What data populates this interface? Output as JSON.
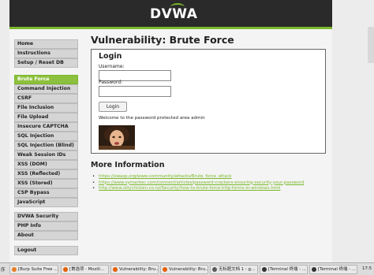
{
  "app": {
    "logo_text": "DVWA",
    "accent_color": "#7ab829",
    "header_color": "#2a2a2a"
  },
  "sidebar": {
    "items": [
      {
        "label": "Home",
        "active": false
      },
      {
        "label": "Instructions",
        "active": false
      },
      {
        "label": "Setup / Reset DB",
        "active": false
      },
      {
        "label": "Brute Force",
        "active": true
      },
      {
        "label": "Command Injection",
        "active": false
      },
      {
        "label": "CSRF",
        "active": false
      },
      {
        "label": "File Inclusion",
        "active": false
      },
      {
        "label": "File Upload",
        "active": false
      },
      {
        "label": "Insecure CAPTCHA",
        "active": false
      },
      {
        "label": "SQL Injection",
        "active": false
      },
      {
        "label": "SQL Injection (Blind)",
        "active": false
      },
      {
        "label": "Weak Session IDs",
        "active": false
      },
      {
        "label": "XSS (DOM)",
        "active": false
      },
      {
        "label": "XSS (Reflected)",
        "active": false
      },
      {
        "label": "XSS (Stored)",
        "active": false
      },
      {
        "label": "CSP Bypass",
        "active": false
      },
      {
        "label": "JavaScript",
        "active": false
      },
      {
        "label": "DVWA Security",
        "active": false
      },
      {
        "label": "PHP Info",
        "active": false
      },
      {
        "label": "About",
        "active": false
      },
      {
        "label": "Logout",
        "active": false
      }
    ]
  },
  "main": {
    "title": "Vulnerability: Brute Force",
    "login": {
      "heading": "Login",
      "username_label": "Username:",
      "username_value": "",
      "password_label": "Password:",
      "password_value": "",
      "button_label": "Login",
      "welcome_text": "Welcome to the password protected area admin"
    },
    "more_info": {
      "heading": "More Information",
      "links": [
        "https://owasp.org/www-community/attacks/Brute_force_attack",
        "https://www.symantec.com/connect/articles/password-crackers-ensuring-security-your-password",
        "http://www.sillychicken.co.nz/Security/how-to-brute-force-http-forms-in-windows.html"
      ]
    }
  },
  "taskbar": {
    "left_text": "序",
    "tasks": [
      {
        "label": "[Burp Suite Free ...",
        "icon": "burp-icon",
        "color": "#e67e22"
      },
      {
        "label": "[首选项 - Mozill...",
        "icon": "firefox-icon",
        "color": "#e66000"
      },
      {
        "label": "Vulnerability: Bru...",
        "icon": "firefox-icon",
        "color": "#e66000"
      },
      {
        "label": "Vulnerability: Bru...",
        "icon": "firefox-icon",
        "color": "#e66000"
      },
      {
        "label": "无标题文档 1 - g...",
        "icon": "document-icon",
        "color": "#5a5a5a"
      },
      {
        "label": "[Terminal 终端 - ...",
        "icon": "terminal-icon",
        "color": "#333333"
      },
      {
        "label": "[Terminal 终端 - ...",
        "icon": "terminal-icon",
        "color": "#333333"
      }
    ],
    "clock": "17:5"
  }
}
